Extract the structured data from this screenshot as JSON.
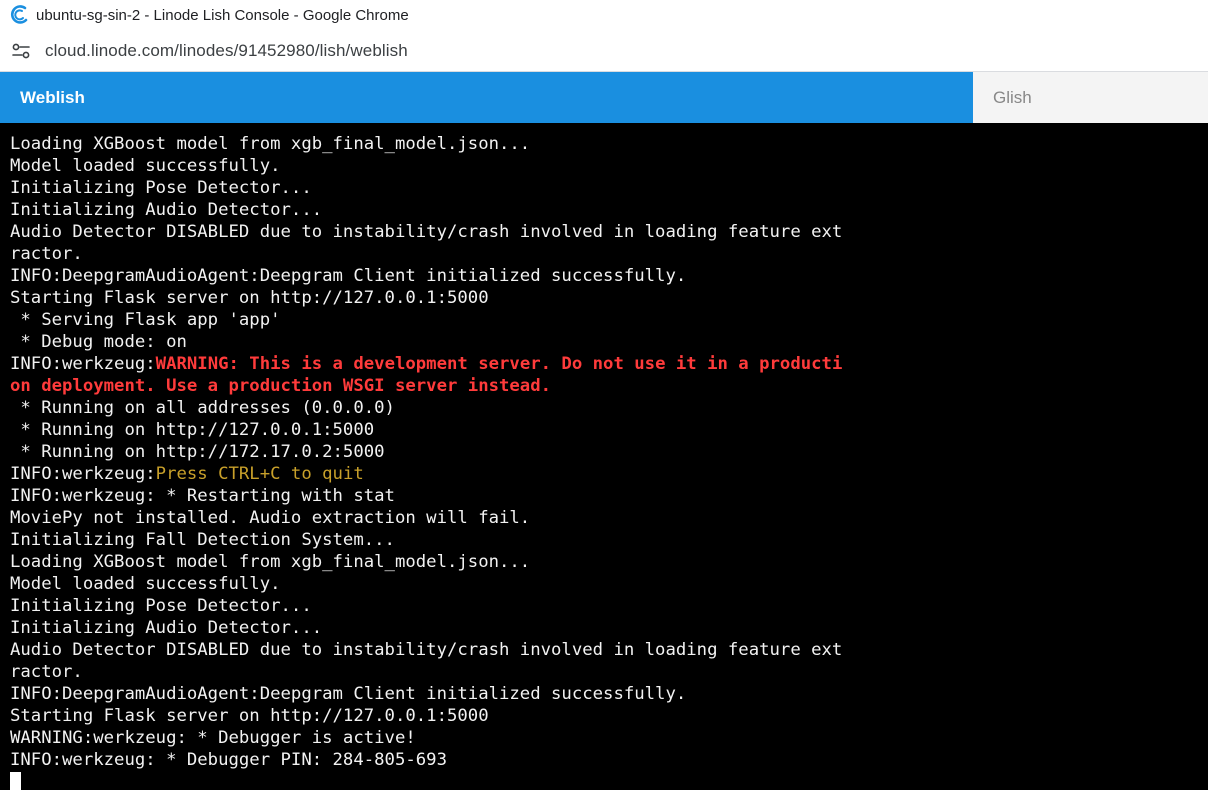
{
  "window": {
    "title": "ubuntu-sg-sin-2 - Linode Lish Console - Google Chrome",
    "url": "cloud.linode.com/linodes/91452980/lish/weblish"
  },
  "tabs": [
    {
      "label": "Weblish",
      "active": true
    },
    {
      "label": "Glish",
      "active": false
    }
  ],
  "colors": {
    "tab_active_bg": "#1a8fe0",
    "tab_inactive_bg": "#f4f4f4",
    "terminal_bg": "#000000",
    "terminal_fg": "#f2f2f2",
    "warning_red": "#ff3b3b",
    "notice_yellow": "#c8a02a"
  },
  "terminal": {
    "lines": [
      [
        {
          "text": "Loading XGBoost model from xgb_final_model.json..."
        }
      ],
      [
        {
          "text": "Model loaded successfully."
        }
      ],
      [
        {
          "text": "Initializing Pose Detector..."
        }
      ],
      [
        {
          "text": "Initializing Audio Detector..."
        }
      ],
      [
        {
          "text": "Audio Detector DISABLED due to instability/crash involved in loading feature ext"
        }
      ],
      [
        {
          "text": "ractor."
        }
      ],
      [
        {
          "text": "INFO:DeepgramAudioAgent:Deepgram Client initialized successfully."
        }
      ],
      [
        {
          "text": "Starting Flask server on http://127.0.0.1:5000"
        }
      ],
      [
        {
          "text": " * Serving Flask app 'app'"
        }
      ],
      [
        {
          "text": " * Debug mode: on"
        }
      ],
      [
        {
          "text": "INFO:werkzeug:"
        },
        {
          "text": "WARNING: This is a development server. Do not use it in a producti",
          "style": "red"
        }
      ],
      [
        {
          "text": "on deployment. Use a production WSGI server instead.",
          "style": "red"
        }
      ],
      [
        {
          "text": " * Running on all addresses (0.0.0.0)"
        }
      ],
      [
        {
          "text": " * Running on http://127.0.0.1:5000"
        }
      ],
      [
        {
          "text": " * Running on http://172.17.0.2:5000"
        }
      ],
      [
        {
          "text": "INFO:werkzeug:"
        },
        {
          "text": "Press CTRL+C to quit",
          "style": "yellow"
        }
      ],
      [
        {
          "text": "INFO:werkzeug: * Restarting with stat"
        }
      ],
      [
        {
          "text": "MoviePy not installed. Audio extraction will fail."
        }
      ],
      [
        {
          "text": "Initializing Fall Detection System..."
        }
      ],
      [
        {
          "text": "Loading XGBoost model from xgb_final_model.json..."
        }
      ],
      [
        {
          "text": "Model loaded successfully."
        }
      ],
      [
        {
          "text": "Initializing Pose Detector..."
        }
      ],
      [
        {
          "text": "Initializing Audio Detector..."
        }
      ],
      [
        {
          "text": "Audio Detector DISABLED due to instability/crash involved in loading feature ext"
        }
      ],
      [
        {
          "text": "ractor."
        }
      ],
      [
        {
          "text": "INFO:DeepgramAudioAgent:Deepgram Client initialized successfully."
        }
      ],
      [
        {
          "text": "Starting Flask server on http://127.0.0.1:5000"
        }
      ],
      [
        {
          "text": "WARNING:werkzeug: * Debugger is active!"
        }
      ],
      [
        {
          "text": "INFO:werkzeug: * Debugger PIN: 284-805-693"
        }
      ]
    ]
  }
}
